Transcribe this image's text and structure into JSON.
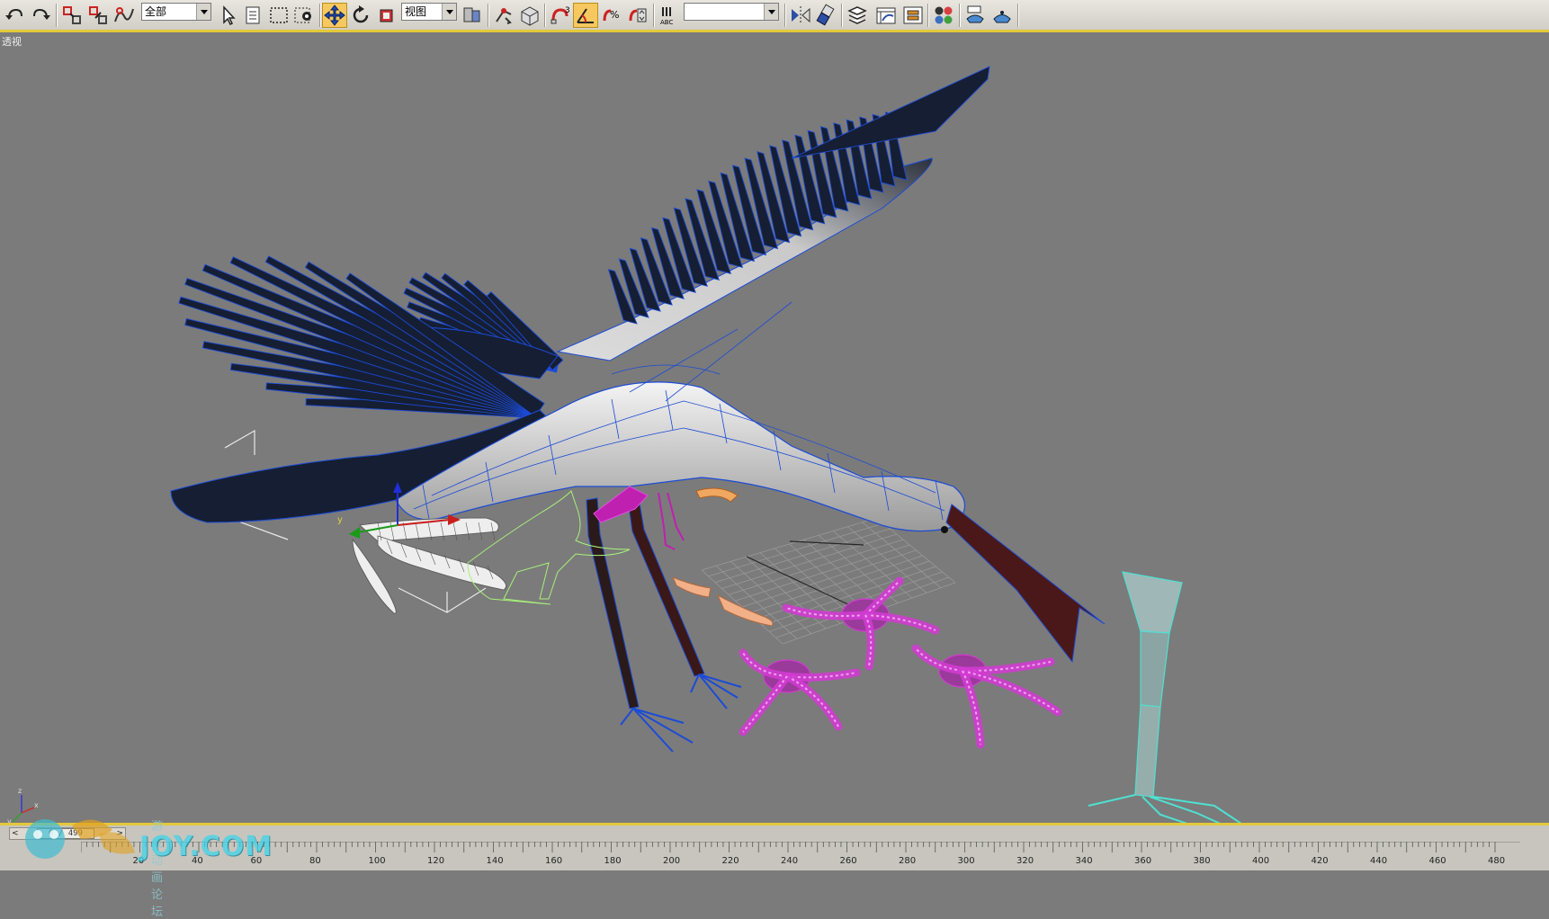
{
  "toolbar": {
    "selection_filter": "全部",
    "reference_coord": "视图",
    "named_selection": "",
    "accent_color": "#e3c93c",
    "active_tool_color": "#f6c85f",
    "icons": [
      "undo-icon",
      "redo-icon",
      "select-and-link-icon",
      "unlink-selection-icon",
      "bind-to-space-warp-icon",
      "select-object-icon",
      "select-by-name-icon",
      "rectangular-selection-region-icon",
      "window-crossing-icon",
      "select-and-move-icon",
      "select-and-rotate-icon",
      "select-and-scale-icon",
      "use-pivot-point-center-icon",
      "select-and-manipulate-icon",
      "keyboard-shortcut-override-icon",
      "snaps-toggle-icon",
      "angle-snap-toggle-icon",
      "percent-snap-toggle-icon",
      "spinner-snap-toggle-icon",
      "edit-named-selection-sets-icon",
      "mirror-icon",
      "align-icon",
      "layer-manager-icon",
      "curve-editor-icon",
      "schematic-view-icon",
      "material-editor-icon",
      "render-setup-icon",
      "render-production-icon"
    ]
  },
  "viewport": {
    "label": "透视",
    "background": "#7b7b7b"
  },
  "timeline": {
    "slider_text": "0 / 499",
    "slider_prev": "<",
    "slider_next": ">",
    "ticks": [
      "20",
      "40",
      "60",
      "80",
      "100",
      "120",
      "140",
      "160",
      "180",
      "200",
      "220",
      "240",
      "260",
      "280",
      "300",
      "320",
      "340",
      "360",
      "380",
      "400",
      "420",
      "440",
      "460",
      "480"
    ]
  },
  "watermark": {
    "text": "JOY.COM",
    "subtitle": "游 戏 动 画 论 坛"
  },
  "scene_colors": {
    "wireframe_blue": "#1c4bd6",
    "feather_dark": "#151e33",
    "body_white": "#e9e9e9",
    "beak": "#5a1a1a",
    "green_mesh": "#a8f07a",
    "magenta_mesh": "#d03cd0",
    "cyan_mesh": "#4fe0d0",
    "orange_mesh": "#f0a860"
  }
}
